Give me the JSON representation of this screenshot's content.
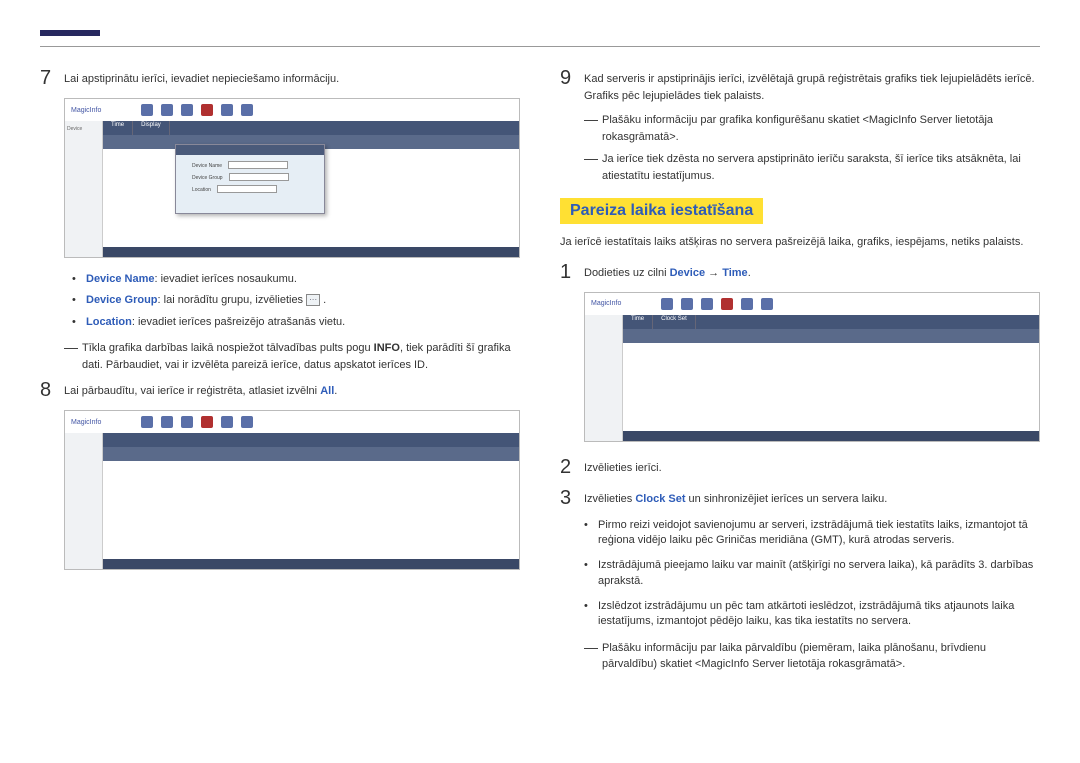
{
  "left": {
    "step7": "Lai apstiprinātu ierīci, ievadiet nepieciešamo informāciju.",
    "deviceNameLabel": "Device Name",
    "deviceNameText": ": ievadiet ierīces nosaukumu.",
    "deviceGroupLabel": "Device Group",
    "deviceGroupText": ": lai norādītu grupu, izvēlieties ",
    "locationLabel": "Location",
    "locationText": ": ievadiet ierīces pašreizējo atrašanās vietu.",
    "dash1a": "Tīkla grafika darbības laikā nospiežot tālvadības pults pogu ",
    "dash1info": "INFO",
    "dash1b": ", tiek parādīti šī grafika dati. Pārbaudiet, vai ir izvēlēta pareizā ierīce, datus apskatot ierīces ID.",
    "step8a": "Lai pārbaudītu, vai ierīce ir reģistrēta, atlasiet izvēlni ",
    "step8all": "All",
    "step8b": ".",
    "ss_logo": "MagicInfo",
    "ss_dialog_row1": "Device Name",
    "ss_dialog_row2": "Device Group",
    "ss_dialog_row3": "Location"
  },
  "right": {
    "step9": "Kad serveris ir apstiprinājis ierīci, izvēlētajā grupā reģistrētais grafiks tiek lejupielādēts ierīcē. Grafiks pēc lejupielādes tiek palaists.",
    "dash1": "Plašāku informāciju par grafika konfigurēšanu skatiet <MagicInfo Server lietotāja rokasgrāmatā>.",
    "dash2": "Ja ierīce tiek dzēsta no servera apstiprināto ierīču saraksta, šī ierīce tiks atsāknēta, lai atiestatītu iestatījumus.",
    "heading": "Pareiza laika iestatīšana",
    "intro": "Ja ierīcē iestatītais laiks atšķiras no servera pašreizējā laika, grafiks, iespējams, netiks palaists.",
    "step1a": "Dodieties uz cilni ",
    "step1device": "Device",
    "step1arrow": " → ",
    "step1time": "Time",
    "step1b": ".",
    "step2": "Izvēlieties ierīci.",
    "step3a": "Izvēlieties ",
    "step3clock": "Clock Set",
    "step3b": " un sinhronizējiet ierīces un servera laiku.",
    "b1": "Pirmo reizi veidojot savienojumu ar serveri, izstrādājumā tiek iestatīts laiks, izmantojot tā reģiona vidējo laiku pēc Griničas meridiāna (GMT), kurā atrodas serveris.",
    "b2": "Izstrādājumā pieejamo laiku var mainīt (atšķirīgi no servera laika), kā parādīts 3. darbības aprakstā.",
    "b3": "Izslēdzot izstrādājumu un pēc tam atkārtoti ieslēdzot, izstrādājumā tiks atjaunots laika iestatījums, izmantojot pēdējo laiku, kas tika iestatīts no servera.",
    "dash3": "Plašāku informāciju par laika pārvaldību (piemēram, laika plānošanu, brīvdienu pārvaldību) skatiet <MagicInfo Server lietotāja rokasgrāmatā>."
  }
}
